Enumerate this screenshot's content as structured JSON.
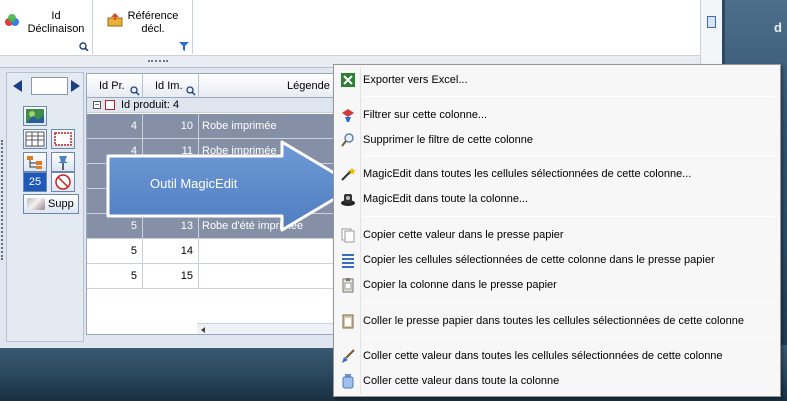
{
  "header_columns": [
    {
      "label_line1": "Id",
      "label_line2": "Déclinaison"
    },
    {
      "label_line1": "Référence",
      "label_line2": "décl."
    }
  ],
  "grid": {
    "columns": [
      "Id Pr.",
      "Id Im.",
      "Légende"
    ],
    "group_label": "Id produit:",
    "group_value": "4",
    "rows": [
      {
        "id_pr": "4",
        "id_im": "10",
        "legende": "Robe imprimée",
        "selected": true
      },
      {
        "id_pr": "4",
        "id_im": "11",
        "legende": "Robe imprimée",
        "selected": true
      },
      {
        "id_pr": "",
        "id_im": "",
        "legende": "",
        "selected": true
      },
      {
        "id_pr": "",
        "id_im": "",
        "legende": "",
        "selected": true
      },
      {
        "id_pr": "5",
        "id_im": "13",
        "legende": "Robe d'été imprimée",
        "selected": true
      },
      {
        "id_pr": "5",
        "id_im": "14",
        "legende": "",
        "selected": false
      },
      {
        "id_pr": "5",
        "id_im": "15",
        "legende": "",
        "selected": false
      }
    ]
  },
  "tools": {
    "page_value": "",
    "blue_button_label": "25",
    "supp_label": "Supp"
  },
  "callout": {
    "text": "Outil MagicEdit",
    "color": "#5b87c8"
  },
  "menu": {
    "items": [
      {
        "label": "Exporter vers Excel...",
        "icon": "excel-icon"
      },
      {
        "label": "Filtrer sur cette colonne...",
        "icon": "filter-icon"
      },
      {
        "label": "Supprimer le filtre de  cette colonne",
        "icon": "magnifier-icon"
      },
      {
        "label": "MagicEdit dans toutes les cellules sélectionnées de cette colonne...",
        "icon": "magic-wand-icon"
      },
      {
        "label": "MagicEdit dans toute la colonne...",
        "icon": "magic-hat-icon"
      },
      {
        "label": "Copier cette valeur dans le presse papier",
        "icon": "copy-icon"
      },
      {
        "label": "Copier les cellules sélectionnées de cette colonne dans le presse papier",
        "icon": "list-icon"
      },
      {
        "label": "Copier la colonne dans le presse papier",
        "icon": "clipboard-copy-icon"
      },
      {
        "label": "Coller le presse papier dans toutes les cellules sélectionnées de cette colonne",
        "icon": "paste-icon"
      },
      {
        "label": "Coller cette valeur dans toutes les cellules sélectionnées de cette colonne",
        "icon": "brush-icon"
      },
      {
        "label": "Coller cette valeur dans toute la colonne",
        "icon": "bottle-icon"
      }
    ]
  },
  "desktop": {
    "corner_letter": "d"
  }
}
